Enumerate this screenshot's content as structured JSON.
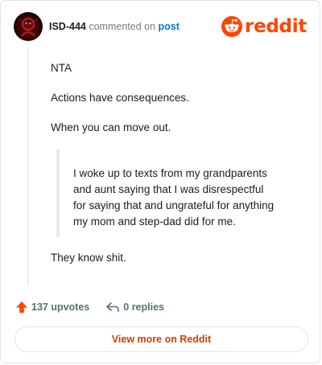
{
  "header": {
    "username": "ISD-444",
    "action": "commented on",
    "post_link": "post",
    "logo_text": "reddit"
  },
  "comment": {
    "paragraphs": [
      "NTA",
      "Actions have consequences.",
      "When you can move out."
    ],
    "quote_lines": [
      "I woke up to texts from my grandparents",
      "and aunt saying that I was disrespectful",
      "for saying that and ungrateful for anything",
      "my mom and step-dad did for me."
    ],
    "closing": "They know shit."
  },
  "footer": {
    "upvotes": "137 upvotes",
    "replies": "0 replies",
    "view_more": "View more on Reddit"
  },
  "icons": {
    "avatar": "avatar-image",
    "logo": "reddit-snoo-icon",
    "upvote": "upvote-arrow-icon",
    "reply": "reply-arrow-icon"
  },
  "colors": {
    "brand": "#ff4500",
    "link": "#0079d3",
    "button_text": "#d93a00",
    "muted": "#576f76"
  }
}
